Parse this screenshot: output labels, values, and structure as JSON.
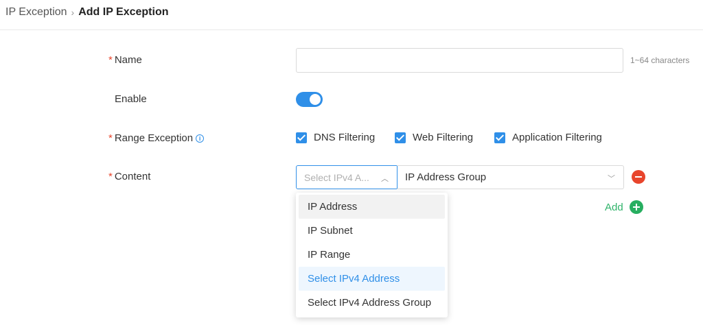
{
  "breadcrumb": {
    "parent": "IP Exception",
    "separator": "›",
    "current": "Add IP Exception"
  },
  "form": {
    "name": {
      "required_mark": "*",
      "label": "Name",
      "value": "",
      "placeholder": "",
      "hint": "1~64 characters"
    },
    "enable": {
      "label": "Enable",
      "on": true
    },
    "range_exception": {
      "required_mark": "*",
      "label": "Range Exception",
      "info_icon": "ⓘ",
      "options": [
        {
          "label": "DNS Filtering",
          "checked": true
        },
        {
          "label": "Web Filtering",
          "checked": true
        },
        {
          "label": "Application Filtering",
          "checked": true
        }
      ]
    },
    "content": {
      "required_mark": "*",
      "label": "Content",
      "type_select": {
        "placeholder": "Select IPv4 A...",
        "chevron": "︿"
      },
      "value_select": {
        "value": "IP Address Group",
        "chevron": "﹀"
      },
      "add_label": "Add"
    }
  },
  "dropdown": {
    "options": [
      {
        "label": "IP Address",
        "state": "hover"
      },
      {
        "label": "IP Subnet",
        "state": ""
      },
      {
        "label": "IP Range",
        "state": ""
      },
      {
        "label": "Select IPv4 Address",
        "state": "active"
      },
      {
        "label": "Select IPv4 Address Group",
        "state": ""
      }
    ]
  },
  "colors": {
    "primary": "#2f8fe8",
    "danger": "#e8452c",
    "success": "#27ae60",
    "required": "#e8452c"
  }
}
